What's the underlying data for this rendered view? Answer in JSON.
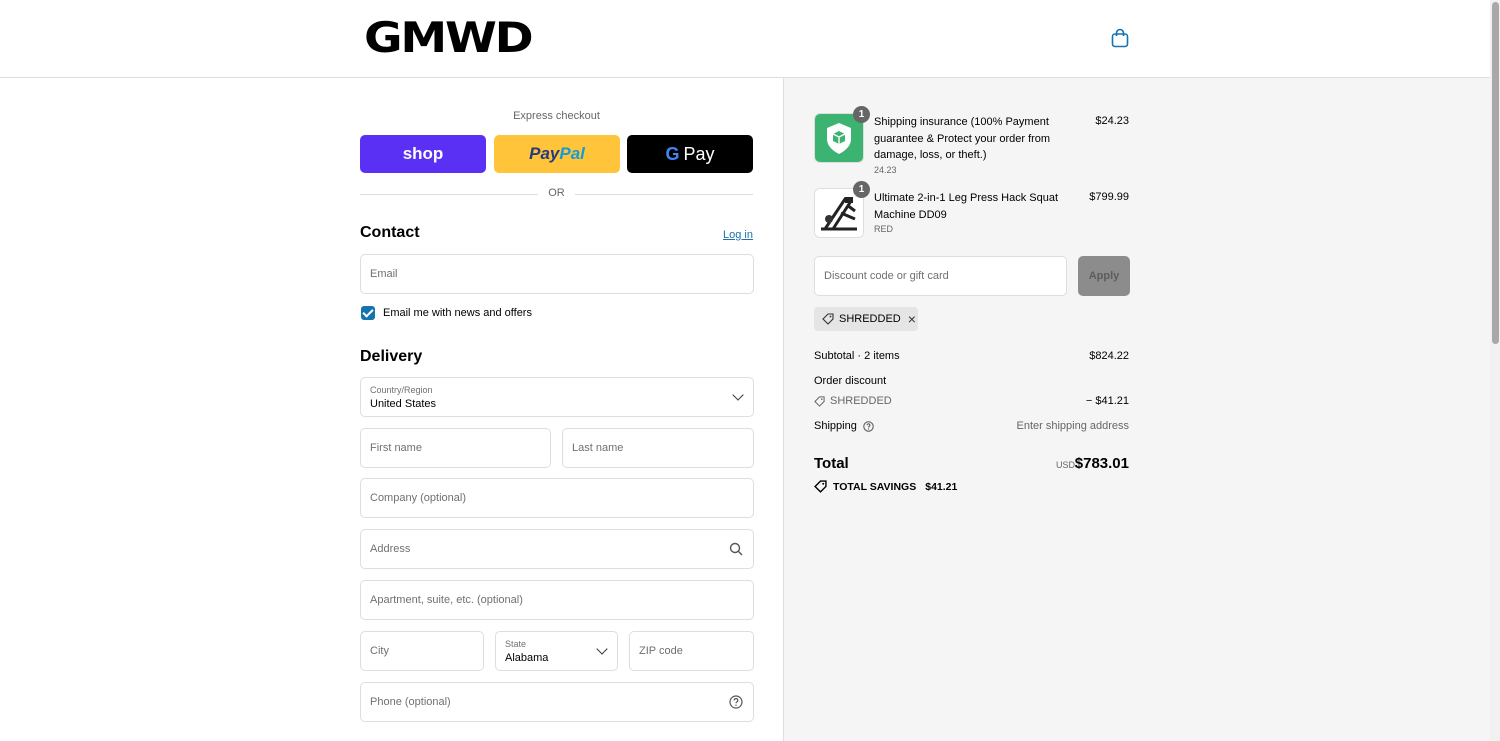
{
  "header": {
    "logo_text": "GMWD",
    "cart_icon": "shopping-bag-icon"
  },
  "express": {
    "label": "Express checkout",
    "shop_label": "shop",
    "paypal_label_a": "Pay",
    "paypal_label_b": "Pal",
    "gpay_g": "G",
    "gpay_label": "Pay",
    "or_label": "OR"
  },
  "contact": {
    "title": "Contact",
    "login_label": "Log in",
    "email_placeholder": "Email",
    "newsletter_label": "Email me with news and offers",
    "newsletter_checked": true
  },
  "delivery": {
    "title": "Delivery",
    "country_label": "Country/Region",
    "country_value": "United States",
    "first_name_placeholder": "First name",
    "last_name_placeholder": "Last name",
    "company_placeholder": "Company (optional)",
    "address_placeholder": "Address",
    "apartment_placeholder": "Apartment, suite, etc. (optional)",
    "city_placeholder": "City",
    "state_label": "State",
    "state_value": "Alabama",
    "zip_placeholder": "ZIP code",
    "phone_placeholder": "Phone (optional)"
  },
  "cart": {
    "items": [
      {
        "title": "Shipping insurance (100% Payment guarantee & Protect your order from damage, loss, or theft.)",
        "subtitle": "24.23",
        "price": "$24.23",
        "quantity": "1"
      },
      {
        "title": "Ultimate 2-in-1 Leg Press Hack Squat Machine DD09",
        "subtitle": "RED",
        "price": "$799.99",
        "quantity": "1"
      }
    ],
    "discount_placeholder": "Discount code or gift card",
    "apply_label": "Apply",
    "coupon_code": "SHREDDED"
  },
  "summary": {
    "subtotal_label": "Subtotal · 2 items",
    "subtotal_value": "$824.22",
    "order_discount_label": "Order discount",
    "discount_code": "SHREDDED",
    "discount_value": "− $41.21",
    "shipping_label": "Shipping",
    "shipping_value": "Enter shipping address",
    "total_label": "Total",
    "currency": "USD",
    "total_value": "$783.01",
    "savings_label": "TOTAL SAVINGS",
    "savings_value": "$41.21"
  },
  "colors": {
    "shop_purple": "#5a31f4",
    "paypal_yellow": "#ffc439",
    "link_blue": "#1773b0",
    "sidebar_bg": "#f5f5f5"
  }
}
